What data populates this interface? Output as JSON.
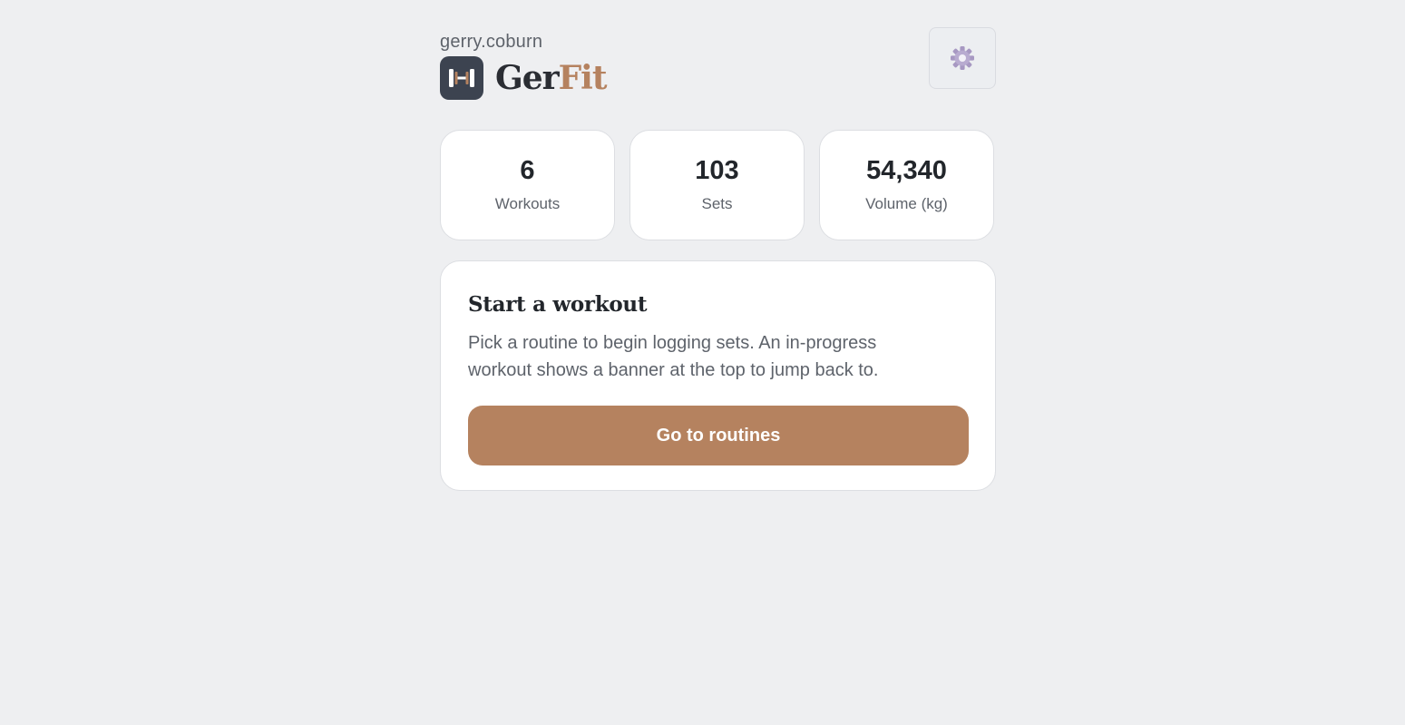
{
  "header": {
    "username": "gerry.coburn",
    "brand_part1": "Ger",
    "brand_part2": "Fit",
    "logo_icon": "dumbbell-icon",
    "settings_icon": "gear-icon"
  },
  "stats": [
    {
      "value": "6",
      "label": "Workouts"
    },
    {
      "value": "103",
      "label": "Sets"
    },
    {
      "value": "54,340",
      "label": "Volume (kg)"
    }
  ],
  "start_card": {
    "title": "Start a workout",
    "description": "Pick a routine to begin logging sets. An in-progress workout shows a banner at the top to jump back to.",
    "button_label": "Go to routines"
  },
  "colors": {
    "background": "#eeeff1",
    "accent": "#b5825f",
    "logo_bg": "#3c4350",
    "text_primary": "#22262b",
    "text_secondary": "#5e636b"
  }
}
